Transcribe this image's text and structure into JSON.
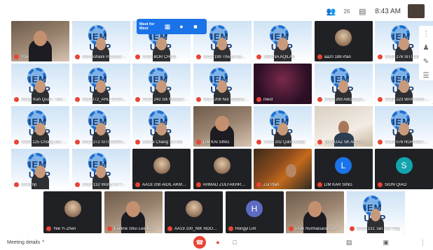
{
  "topbar": {
    "participants_count": "26",
    "chat_icon": "chat-icon",
    "time": "8:43 AM"
  },
  "meet_toolbar": {
    "brand": "Meet for Meet"
  },
  "tiles": [
    {
      "name": "You",
      "style": "room"
    },
    {
      "name": "Hemleshaini Panneerselvam",
      "style": "iem"
    },
    {
      "name": "CHIN BOR CHOO",
      "style": "iem"
    },
    {
      "name": "AA18 199 Thivya Kamini",
      "style": "iem"
    },
    {
      "name": "SERINA AQILAH",
      "style": "iem"
    },
    {
      "name": "aa20 188 irfan",
      "style": "dark-photo"
    },
    {
      "name": "AA19 276 SITI NOR",
      "style": "iem"
    },
    {
      "name": "Wong Kah Quan - Nelson",
      "style": "iem"
    },
    {
      "name": "AA19272_AHD SYAHMI A...",
      "style": "iem"
    },
    {
      "name": "AA19 243 Siti Nurfadilah",
      "style": "iem"
    },
    {
      "name": "AA17 208 Nur Shahidah B...",
      "style": "iem"
    },
    {
      "name": "meor",
      "style": "night"
    },
    {
      "name": "AA19 269 ABDULLAH A...",
      "style": "iem"
    },
    {
      "name": "AA19 223 WAN NUR A...",
      "style": "iem"
    },
    {
      "name": "AA19 125 Chong Jun Min",
      "style": "iem"
    },
    {
      "name": "AA19 272 SITI NORHAFI...",
      "style": "iem"
    },
    {
      "name": "Jolene Chang Yin Nei",
      "style": "iem"
    },
    {
      "name": "LIM KAI SING",
      "style": "room"
    },
    {
      "name": "AA19 202 Qatrunnada",
      "style": "iem"
    },
    {
      "name": "SB MUAZ SK ABD RAZAK",
      "style": "bedroom"
    },
    {
      "name": "AA19 076 NURNIDA SYA...",
      "style": "iem"
    },
    {
      "name": "xin lamp",
      "style": "iem"
    },
    {
      "name": "AA19 132 Wong Yu Tyan",
      "style": "iem"
    },
    {
      "name": "AA18 208 AIDIL AKMAL ...",
      "style": "dark-photo"
    },
    {
      "name": "AHMAD ZULFAKHROL H...",
      "style": "dark-photo"
    },
    {
      "name": "Zul Irfan",
      "style": "autumn"
    },
    {
      "name": "LIM KAR SING",
      "style": "dark-letter",
      "letter": "L",
      "color": "#1a73e8"
    },
    {
      "name": "SION QIAO",
      "style": "dark-letter",
      "letter": "S",
      "color": "#12a4af"
    },
    {
      "name": "Yee Yi Zhen",
      "style": "dark-photo"
    },
    {
      "name": "Eveline Shui Lee Kei...",
      "style": "room"
    },
    {
      "name": "AA19 100_NIK NOOR AT...",
      "style": "dark-photo"
    },
    {
      "name": "Hongyi Lim",
      "style": "dark-letter",
      "letter": "H",
      "color": "#5c6bc0"
    },
    {
      "name": "Putri Nurmaisarah Bint...",
      "style": "room"
    },
    {
      "name": "AA19 131 Tan Wei Ying",
      "style": "iem"
    }
  ],
  "iem_word": "IEM UMP",
  "bottom": {
    "meeting_details": "Meeting details",
    "chevron": "^"
  }
}
